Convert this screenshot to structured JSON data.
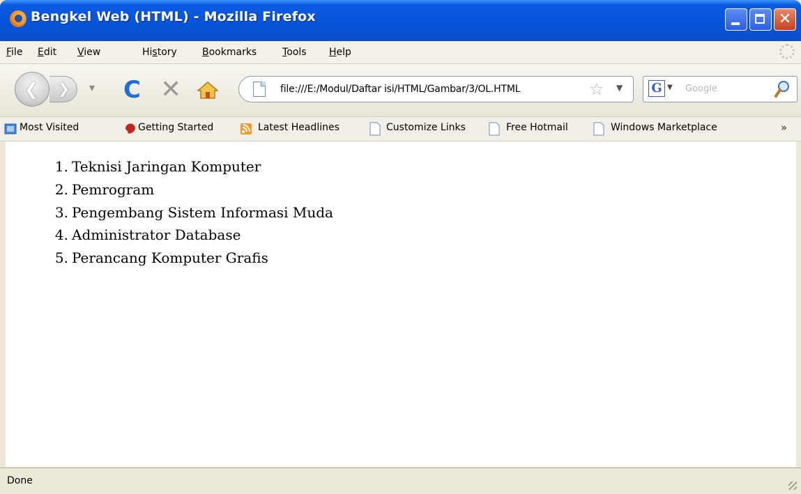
{
  "window": {
    "title": "Bengkel Web (HTML) - Mozilla Firefox",
    "controls": [
      "minimize-icon",
      "maximize-icon",
      "close-icon"
    ]
  },
  "menubar": {
    "items": [
      {
        "label": "File",
        "key": "F",
        "rest": "ile"
      },
      {
        "label": "Edit",
        "key": "E",
        "rest": "dit"
      },
      {
        "label": "View",
        "key": "V",
        "rest": "iew"
      },
      {
        "label": "History",
        "pre": "Hi",
        "key": "s",
        "rest": "tory"
      },
      {
        "label": "Bookmarks",
        "key": "B",
        "rest": "ookmarks"
      },
      {
        "label": "Tools",
        "key": "T",
        "rest": "ools"
      },
      {
        "label": "Help",
        "key": "H",
        "rest": "elp"
      }
    ]
  },
  "navbar": {
    "back_icon": "back-arrow-icon",
    "forward_icon": "forward-arrow-icon",
    "reload_glyph": "C",
    "stop_glyph": "✕",
    "home_icon": "home-icon",
    "url": "file:///E:/Modul/Daftar isi/HTML/Gambar/3/OL.HTML",
    "search_engine": "G",
    "search_placeholder": "Google",
    "accent": "#1e6ed6"
  },
  "bookmarks": {
    "items": [
      {
        "label": "Most Visited",
        "icon": "most-visited-icon"
      },
      {
        "label": "Getting Started",
        "icon": "firefox-red-icon"
      },
      {
        "label": "Latest Headlines",
        "icon": "rss-icon"
      },
      {
        "label": "Customize Links",
        "icon": "page-icon"
      },
      {
        "label": "Free Hotmail",
        "icon": "page-icon"
      },
      {
        "label": "Windows Marketplace",
        "icon": "page-icon"
      }
    ],
    "overflow": "»"
  },
  "content": {
    "ordered_list": [
      {
        "num": "1.",
        "text": "Teknisi Jaringan Komputer"
      },
      {
        "num": "2.",
        "text": "Pemrogram"
      },
      {
        "num": "3.",
        "text": "Pengembang Sistem Informasi Muda"
      },
      {
        "num": "4.",
        "text": "Administrator Database"
      },
      {
        "num": "5.",
        "text": "Perancang Komputer Grafis"
      }
    ]
  },
  "status": {
    "text": "Done"
  }
}
